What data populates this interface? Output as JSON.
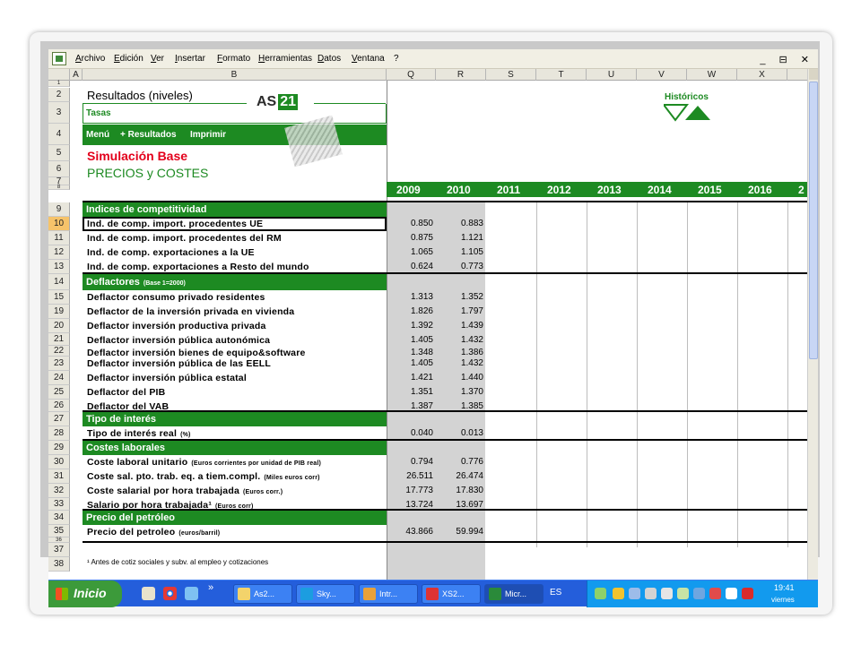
{
  "menu": {
    "items": [
      "Archivo",
      "Edición",
      "Ver",
      "Insertar",
      "Formato",
      "Herramientas",
      "Datos",
      "Ventana",
      "?"
    ],
    "window_controls": "_ ⊟ ✕"
  },
  "columns": [
    "A",
    "B",
    "Q",
    "R",
    "S",
    "T",
    "U",
    "V",
    "W",
    "X"
  ],
  "header": {
    "results_title": "Resultados (niveles)",
    "logo_text": "AS",
    "logo_digits": "21",
    "tasas": "Tasas",
    "menu_label": "Menú",
    "resultados_label": "+ Resultados",
    "imprimir_label": "Imprimir",
    "simulacion": "Simulación Base",
    "precios": "PRECIOS y COSTES",
    "historicos": "Históricos"
  },
  "years": [
    "2009",
    "2010",
    "2011",
    "2012",
    "2013",
    "2014",
    "2015",
    "2016",
    "2"
  ],
  "row_numbers": [
    "1",
    "2",
    "3",
    "4",
    "5",
    "6",
    "7",
    "8",
    "9",
    "10",
    "11",
    "12",
    "13",
    "14",
    "15",
    "19",
    "20",
    "21",
    "22",
    "23",
    "24",
    "25",
    "26",
    "27",
    "28",
    "29",
    "30",
    "31",
    "32",
    "33",
    "34",
    "35",
    "36",
    "37",
    "38"
  ],
  "sections": [
    {
      "title": "Indices de competitividad"
    },
    {
      "title": "Deflactores",
      "note": "(Base 1=2000)"
    },
    {
      "title": "Tipo de interés"
    },
    {
      "title": "Costes laborales"
    },
    {
      "title": "Precio del petróleo"
    }
  ],
  "rows": [
    {
      "label": "Ind. de comp. import. procedentes UE",
      "note": "",
      "q": "0.850",
      "r": "0.883"
    },
    {
      "label": "Ind. de comp. import. procedentes del RM",
      "note": "",
      "q": "0.875",
      "r": "1.121"
    },
    {
      "label": "Ind. de comp. exportaciones a la UE",
      "note": "",
      "q": "1.065",
      "r": "1.105"
    },
    {
      "label": "Ind. de comp. exportaciones a Resto del mundo",
      "note": "",
      "q": "0.624",
      "r": "0.773"
    },
    {
      "label": "Deflactor consumo privado residentes",
      "note": "",
      "q": "1.313",
      "r": "1.352"
    },
    {
      "label": "Deflactor de la inversión privada en vivienda",
      "note": "",
      "q": "1.826",
      "r": "1.797"
    },
    {
      "label": "Deflactor inversión productiva privada",
      "note": "",
      "q": "1.392",
      "r": "1.439"
    },
    {
      "label": "Deflactor inversión pública autonómica",
      "note": "",
      "q": "1.405",
      "r": "1.432"
    },
    {
      "label": "Deflactor inversión bienes de equipo&software",
      "note": "",
      "q": "1.348",
      "r": "1.386"
    },
    {
      "label": "Deflactor inversión pública de las EELL",
      "note": "",
      "q": "1.405",
      "r": "1.432"
    },
    {
      "label": "Deflactor inversión pública estatal",
      "note": "",
      "q": "1.421",
      "r": "1.440"
    },
    {
      "label": "Deflactor del PIB",
      "note": "",
      "q": "1.351",
      "r": "1.370"
    },
    {
      "label": "Deflactor del VAB",
      "note": "",
      "q": "1.387",
      "r": "1.385"
    },
    {
      "label": "Tipo de interés real",
      "note": "(%)",
      "q": "0.040",
      "r": "0.013"
    },
    {
      "label": "Coste laboral unitario",
      "note": "(Euros corrientes por unidad de PIB real)",
      "q": "0.794",
      "r": "0.776"
    },
    {
      "label": "Coste sal. pto. trab. eq. a tiem.compl.",
      "note": "(Miles euros corr)",
      "q": "26.511",
      "r": "26.474"
    },
    {
      "label": "Coste salarial por hora trabajada",
      "note": "(Euros corr.)",
      "q": "17.773",
      "r": "17.830"
    },
    {
      "label": "Salario por hora trabajada¹",
      "note": "(Euros corr)",
      "q": "13.724",
      "r": "13.697"
    },
    {
      "label": "Precio del petroleo",
      "note": "(euros/barril)",
      "q": "43.866",
      "r": "59.994"
    }
  ],
  "footnote": "¹ Antes de cotiz sociales y subv. al empleo y cotizaciones",
  "taskbar": {
    "start": "Inicio",
    "chevron": "»",
    "tasks": [
      "As2...",
      "Sky...",
      "Intr...",
      "XS2...",
      "Micr..."
    ],
    "lang": "ES",
    "time": "19:41",
    "day": "viernes"
  },
  "colors": {
    "green": "#1d8a22",
    "title_red": "#e3001b",
    "selected_row": "#f6c36a",
    "taskbar": "#245edb"
  }
}
